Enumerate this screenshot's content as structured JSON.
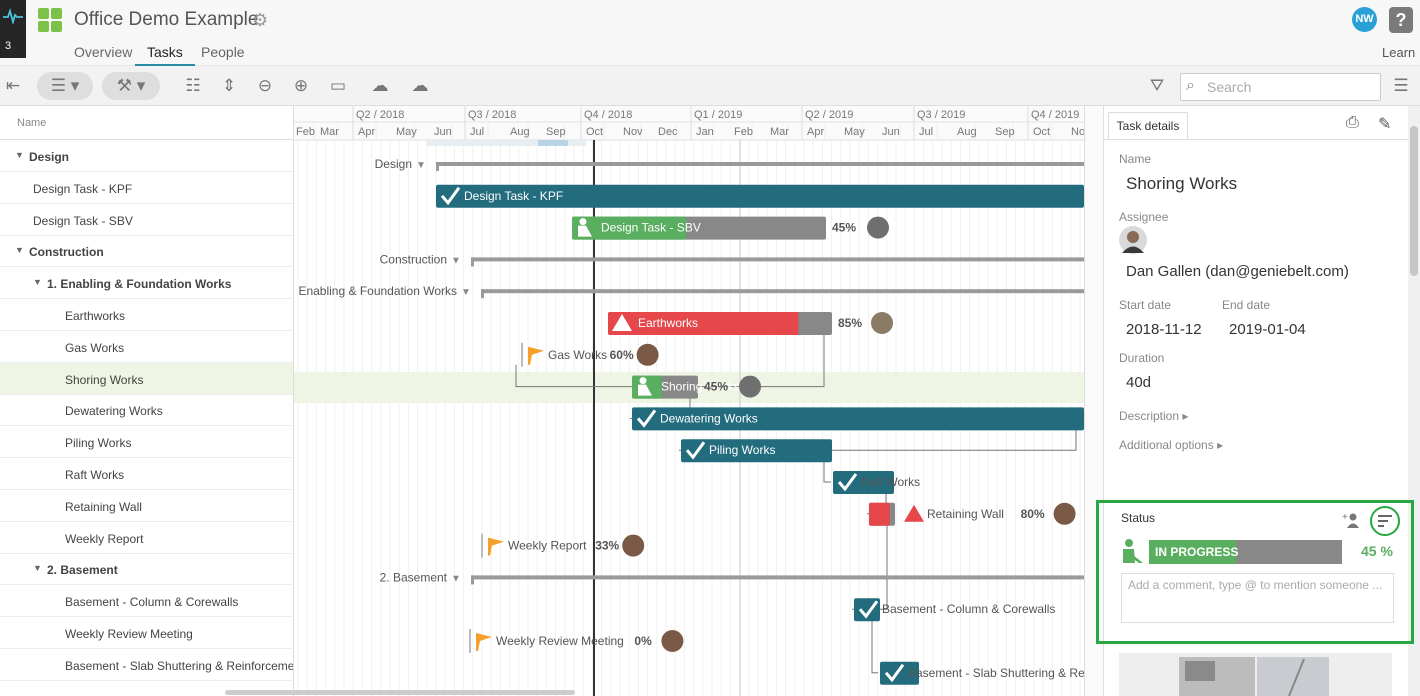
{
  "header": {
    "badge_count": "3",
    "project_title": "Office Demo Example",
    "nav_tabs": [
      {
        "label": "Overview",
        "active": false
      },
      {
        "label": "Tasks",
        "active": true
      },
      {
        "label": "People",
        "active": false
      }
    ],
    "user_initials": "NW",
    "help_label": "?",
    "learn_label": "Learn",
    "accent_color": "#2a8ca0"
  },
  "toolbar": {
    "search_placeholder": "Search"
  },
  "tree": {
    "column_header": "Name",
    "rows": [
      {
        "label": "Design",
        "level": 0,
        "group": true,
        "selected": false
      },
      {
        "label": "Design Task - KPF",
        "level": 1,
        "group": false,
        "selected": false
      },
      {
        "label": "Design Task - SBV",
        "level": 1,
        "group": false,
        "selected": false
      },
      {
        "label": "Construction",
        "level": 0,
        "group": true,
        "selected": false
      },
      {
        "label": "1. Enabling & Foundation Works",
        "level": 1,
        "group": true,
        "selected": false
      },
      {
        "label": "Earthworks",
        "level": 2,
        "group": false,
        "selected": false
      },
      {
        "label": "Gas Works",
        "level": 2,
        "group": false,
        "selected": false
      },
      {
        "label": "Shoring Works",
        "level": 2,
        "group": false,
        "selected": true
      },
      {
        "label": "Dewatering Works",
        "level": 2,
        "group": false,
        "selected": false
      },
      {
        "label": "Piling Works",
        "level": 2,
        "group": false,
        "selected": false
      },
      {
        "label": "Raft Works",
        "level": 2,
        "group": false,
        "selected": false
      },
      {
        "label": "Retaining Wall",
        "level": 2,
        "group": false,
        "selected": false
      },
      {
        "label": "Weekly Report",
        "level": 2,
        "group": false,
        "selected": false
      },
      {
        "label": "2. Basement",
        "level": 1,
        "group": true,
        "selected": false
      },
      {
        "label": "Basement - Column & Corewalls",
        "level": 2,
        "group": false,
        "selected": false
      },
      {
        "label": "Weekly Review Meeting",
        "level": 2,
        "group": false,
        "selected": false
      },
      {
        "label": "Basement - Slab Shuttering & Reinforcement",
        "level": 2,
        "group": false,
        "selected": false
      }
    ]
  },
  "gantt": {
    "quarters": [
      "Q2 / 2018",
      "Q3 / 2018",
      "Q4 / 2018",
      "Q1 / 2019",
      "Q2 / 2019",
      "Q3 / 2019",
      "Q4 / 2019"
    ],
    "months": [
      "Feb",
      "Mar",
      "Apr",
      "May",
      "Jun",
      "Jul",
      "Aug",
      "Sep",
      "Oct",
      "Nov",
      "Dec",
      "Jan",
      "Feb",
      "Mar",
      "Apr",
      "May",
      "Jun",
      "Jul",
      "Aug",
      "Sep",
      "Oct",
      "Nov"
    ],
    "colors": {
      "done": "#236c7e",
      "progress": "#5aae5f",
      "remaining": "#888888",
      "late": "#e5474b",
      "milestone": "#f5a02a",
      "summary": "#9a9a9a"
    },
    "tasks": [
      {
        "label": "Design",
        "kind": "summary"
      },
      {
        "label": "Design Task - KPF",
        "kind": "done"
      },
      {
        "label": "Design Task - SBV",
        "kind": "progress",
        "percent": "45%",
        "fraction": 0.45
      },
      {
        "label": "Construction",
        "kind": "summary"
      },
      {
        "label": "1. Enabling & Foundation Works",
        "kind": "summary"
      },
      {
        "label": "Earthworks",
        "kind": "late",
        "percent": "85%",
        "fraction": 0.85
      },
      {
        "label": "Gas Works",
        "kind": "milestone",
        "percent": "60%"
      },
      {
        "label": "Shoring Works",
        "kind": "progress",
        "percent": "45%",
        "fraction": 0.45
      },
      {
        "label": "Dewatering Works",
        "kind": "done"
      },
      {
        "label": "Piling Works",
        "kind": "done"
      },
      {
        "label": "Raft Works",
        "kind": "done"
      },
      {
        "label": "Retaining Wall",
        "kind": "late",
        "percent": "80%",
        "fraction": 0.8
      },
      {
        "label": "Weekly Report",
        "kind": "milestone",
        "percent": "33%"
      },
      {
        "label": "2. Basement",
        "kind": "summary"
      },
      {
        "label": "Basement - Column & Corewalls",
        "kind": "done"
      },
      {
        "label": "Weekly Review Meeting",
        "kind": "milestone",
        "percent": "0%"
      },
      {
        "label": "Basement - Slab Shuttering & Re",
        "kind": "done"
      }
    ]
  },
  "details": {
    "tab_label": "Task details",
    "name_label": "Name",
    "name_value": "Shoring Works",
    "assignee_label": "Assignee",
    "assignee_value": "Dan Gallen (dan@geniebelt.com)",
    "start_label": "Start date",
    "start_value": "2018-11-12",
    "end_label": "End date",
    "end_value": "2019-01-04",
    "duration_label": "Duration",
    "duration_value": "40d",
    "description_label": "Description ▸",
    "options_label": "Additional options ▸",
    "status_label": "Status",
    "status_text": "IN PROGRESS",
    "status_percent": "45 %",
    "status_fraction": 0.45,
    "status_color": "#5aae5f",
    "highlight_color": "#28a745",
    "comment_placeholder": "Add a comment, type @ to mention someone ..."
  }
}
